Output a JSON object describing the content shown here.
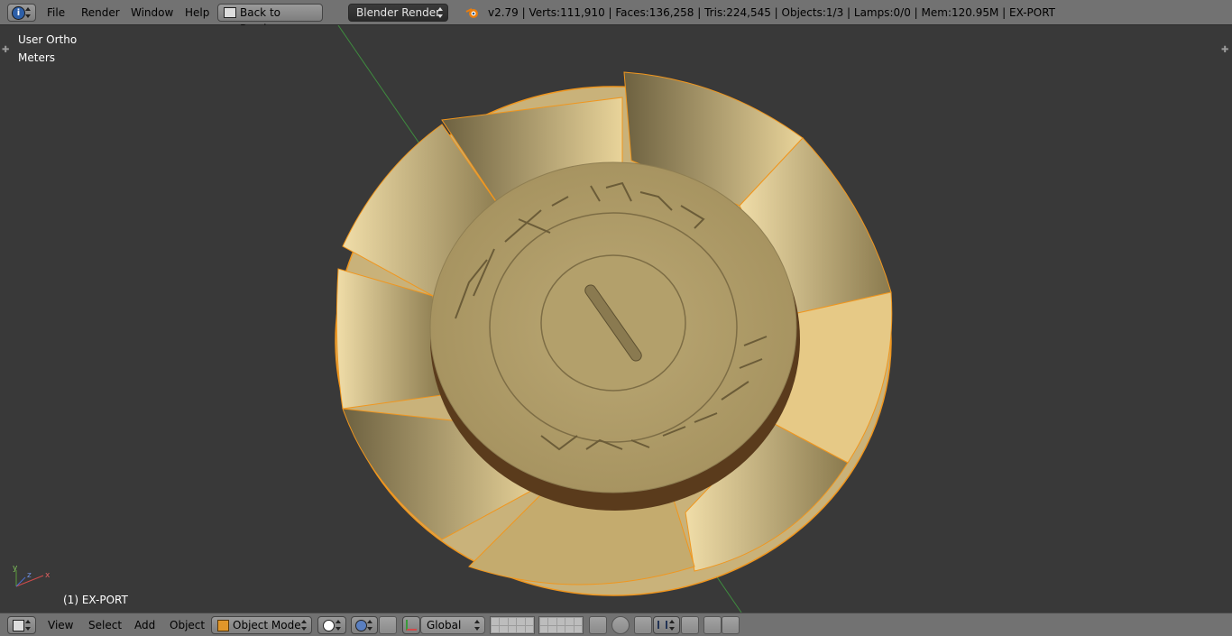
{
  "topbar": {
    "editor_icon": "info-icon",
    "menus": [
      "File",
      "Render",
      "Window",
      "Help"
    ],
    "back_button_label": "Back to Previous",
    "render_engine": "Blender Render",
    "stats": "v2.79 | Verts:111,910 | Faces:136,258 | Tris:224,545 | Objects:1/3 | Lamps:0/0 | Mem:120.95M | EX-PORT"
  },
  "viewport": {
    "view_name": "User Ortho",
    "units": "Meters",
    "object_label": "(1) EX-PORT",
    "axis_labels": [
      "y",
      "z",
      "x"
    ]
  },
  "bottombar": {
    "editor_icon": "3d-view-icon",
    "menus": [
      "View",
      "Select",
      "Add",
      "Object"
    ],
    "mode": "Object Mode",
    "orientation": "Global"
  },
  "colors": {
    "header": "#727272",
    "viewport_bg": "#393939",
    "object_gold": "#c9b27a",
    "selection_outline": "#f0961e"
  }
}
